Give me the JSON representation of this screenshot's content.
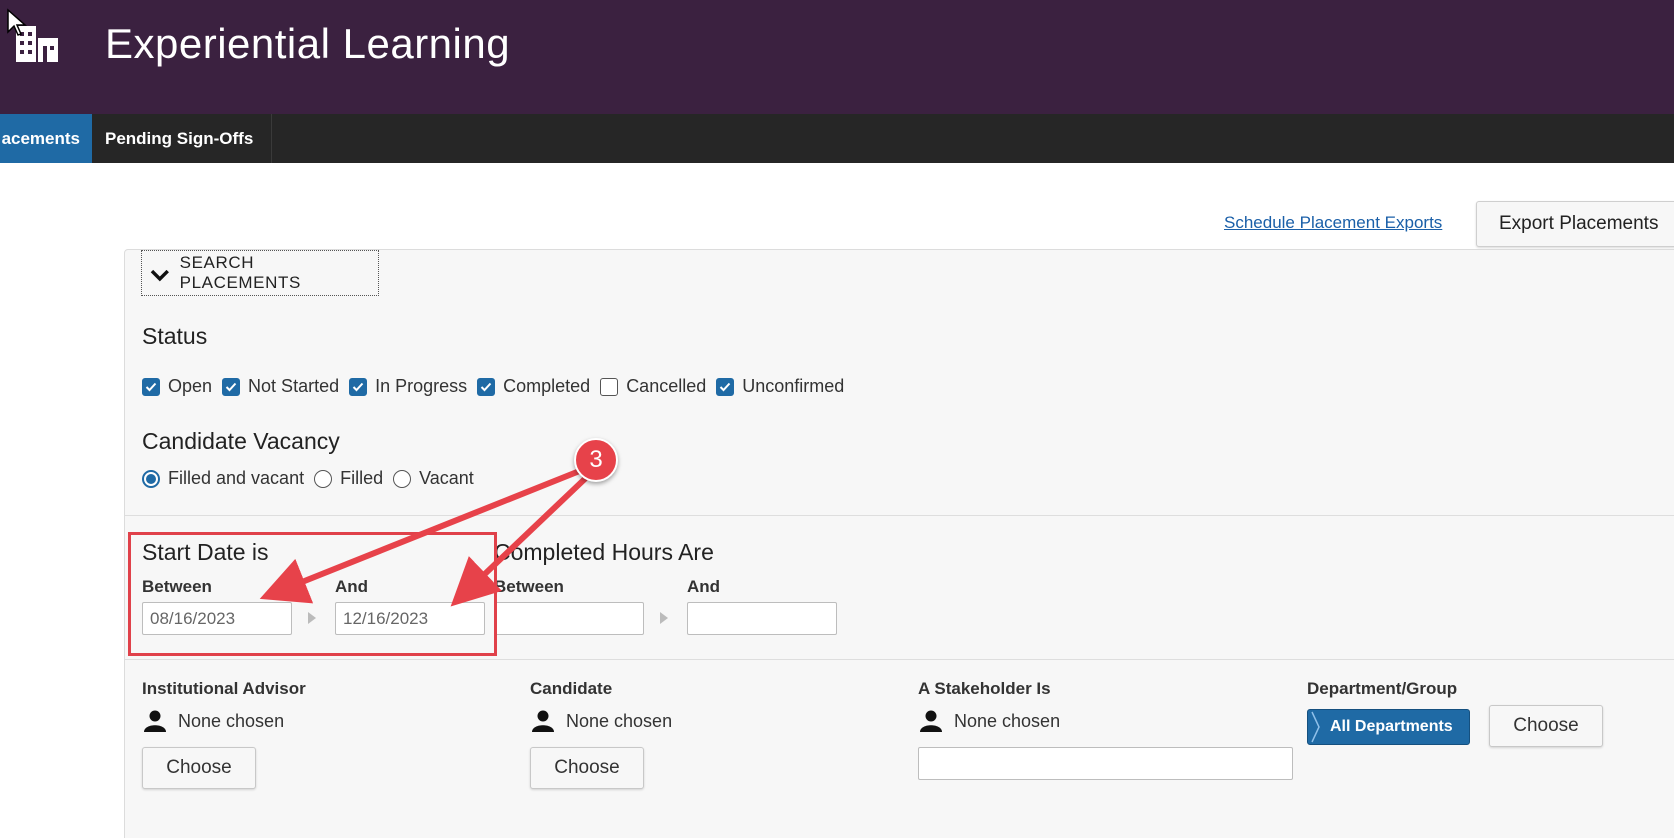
{
  "header": {
    "app_title": "Experiential Learning"
  },
  "nav": {
    "tabs": [
      {
        "label": "acements",
        "active": true
      },
      {
        "label": "Pending Sign-Offs",
        "active": false
      }
    ]
  },
  "toolbar": {
    "schedule_link": "Schedule Placement Exports",
    "export_button": "Export Placements"
  },
  "search": {
    "toggle_label": "SEARCH PLACEMENTS",
    "status": {
      "title": "Status",
      "options": [
        {
          "label": "Open",
          "checked": true
        },
        {
          "label": "Not Started",
          "checked": true
        },
        {
          "label": "In Progress",
          "checked": true
        },
        {
          "label": "Completed",
          "checked": true
        },
        {
          "label": "Cancelled",
          "checked": false
        },
        {
          "label": "Unconfirmed",
          "checked": true
        }
      ]
    },
    "vacancy": {
      "title": "Candidate Vacancy",
      "options": [
        {
          "label": "Filled and vacant",
          "selected": true
        },
        {
          "label": "Filled",
          "selected": false
        },
        {
          "label": "Vacant",
          "selected": false
        }
      ]
    },
    "start_date": {
      "title": "Start Date is",
      "between_label": "Between",
      "and_label": "And",
      "from_value": "08/16/2023",
      "to_value": "12/16/2023"
    },
    "completed_hours": {
      "title": "Completed Hours Are",
      "between_label": "Between",
      "and_label": "And",
      "from_value": "",
      "to_value": ""
    },
    "advisor": {
      "label": "Institutional Advisor",
      "value": "None chosen",
      "button": "Choose"
    },
    "candidate": {
      "label": "Candidate",
      "value": "None chosen",
      "button": "Choose"
    },
    "stakeholder": {
      "label": "A Stakeholder Is",
      "value": "None chosen",
      "input_value": ""
    },
    "department": {
      "label": "Department/Group",
      "tag": "All Departments",
      "button": "Choose"
    }
  },
  "annotation": {
    "step_number": "3",
    "color": "#e7424a"
  },
  "colors": {
    "header_bg": "#3b2140",
    "nav_bg": "#262626",
    "accent": "#1f6aa5",
    "link": "#1a5fa8"
  }
}
